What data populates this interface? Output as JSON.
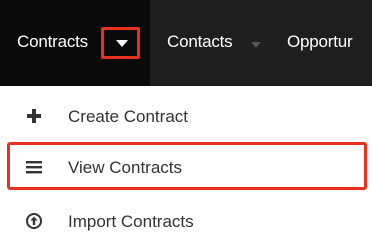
{
  "nav": {
    "tabs": [
      {
        "label": "Contracts",
        "active": true
      },
      {
        "label": "Contacts"
      },
      {
        "label": "Opportur"
      }
    ]
  },
  "menu": {
    "items": [
      {
        "label": "Create Contract",
        "icon": "plus-icon"
      },
      {
        "label": "View Contracts",
        "icon": "list-icon",
        "highlighted": true
      },
      {
        "label": "Import Contracts",
        "icon": "upload-circle-icon"
      }
    ]
  },
  "colors": {
    "nav_background": "#1e1e1e",
    "nav_active": "#0a0a0a",
    "highlight": "#e8321e",
    "menu_text": "#333333"
  }
}
